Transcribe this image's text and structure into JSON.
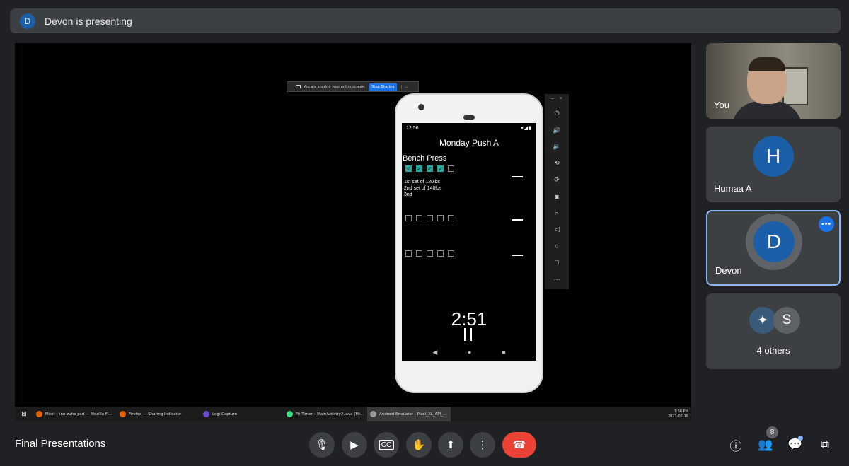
{
  "presenting_bar": {
    "avatar_initial": "D",
    "text": "Devon is presenting"
  },
  "shared_screen": {
    "share_banner": {
      "text": "You are sharing your entire screen.",
      "stop_label": "Stop Sharing",
      "more_label": "..."
    },
    "phone_app": {
      "status_time": "12:56",
      "status_icons": "▾◢▮",
      "title": "Monday Push A",
      "exercise": "Bench Press",
      "set_lines": [
        "1st set of 120lbs",
        "2nd set of 140lbs",
        "3nd"
      ],
      "checkbox_rows": [
        [
          true,
          true,
          true,
          true,
          false
        ],
        [
          false,
          false,
          false,
          false,
          false
        ],
        [
          false,
          false,
          false,
          false,
          false
        ]
      ],
      "timer": "2:51",
      "nav": {
        "back": "◀",
        "home": "●",
        "recents": "■"
      }
    },
    "emulator_toolbar": {
      "minimize": "–",
      "close": "×",
      "icons": [
        "power-icon",
        "volume-up-icon",
        "volume-down-icon",
        "rotate-left-icon",
        "rotate-right-icon",
        "camera-icon",
        "zoom-icon",
        "back-icon",
        "home-icon",
        "overview-icon",
        "more-icon"
      ]
    },
    "taskbar": {
      "items": [
        {
          "label": "Meet – ino-zuhc-psd — Mozilla Fi...",
          "color": "#e66000",
          "active": false
        },
        {
          "label": "Firefox — Sharing Indicator",
          "color": "#e66000",
          "active": false
        },
        {
          "label": "Logi Capture",
          "color": "#6c4cd6",
          "active": false
        },
        {
          "label": "Fit Timer – MainActivity2.java [Fit...",
          "color": "#3ddc84",
          "active": false
        },
        {
          "label": "Android Emulator - Pixel_XL_API_...",
          "color": "#999999",
          "active": true
        }
      ],
      "time": "1:56 PM",
      "date": "2021-06-16"
    }
  },
  "participants": [
    {
      "name": "You",
      "type": "video"
    },
    {
      "name": "Humaa A",
      "initial": "H",
      "type": "avatar"
    },
    {
      "name": "Devon",
      "initial": "D",
      "type": "avatar",
      "selected": true
    },
    {
      "label": "4 others",
      "initial": "S",
      "type": "group"
    }
  ],
  "bottom_bar": {
    "meeting_name": "Final Presentations",
    "people_count": "8"
  },
  "colors": {
    "accent": "#8ab4f8",
    "end_call": "#ea4335",
    "avatar": "#1a5fa7",
    "checkbox_on": "#26a69a"
  }
}
